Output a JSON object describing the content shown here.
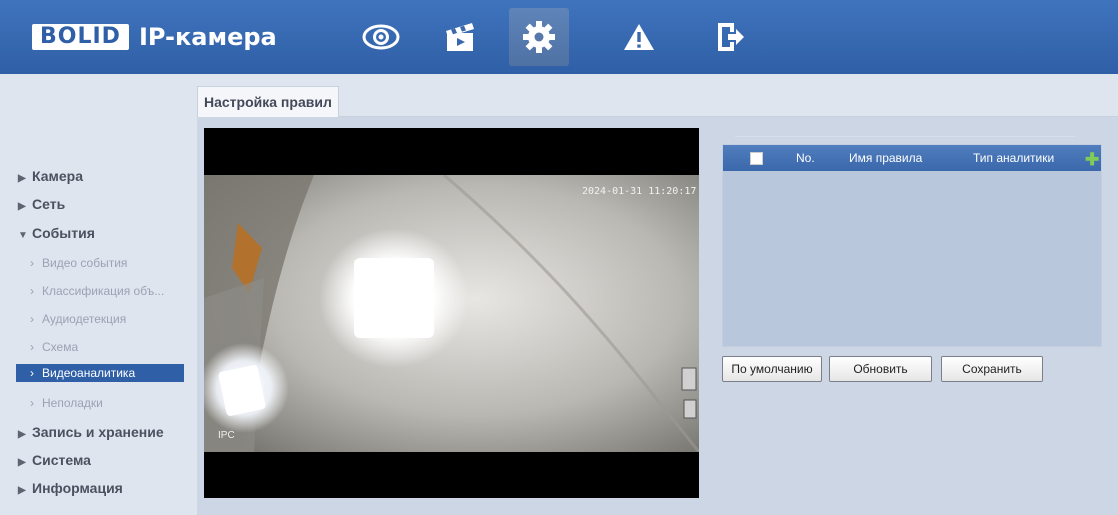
{
  "header": {
    "logo_box": "BOLID",
    "logo_text": "IP-камера",
    "nav_icons": [
      "eye-icon",
      "clapperboard-icon",
      "gear-icon",
      "warning-icon",
      "exit-icon"
    ],
    "active_nav": "gear-icon"
  },
  "sidebar": {
    "camera": "Камера",
    "network": "Сеть",
    "events": "События",
    "sub": {
      "video_events": "Видео события",
      "object_class": "Классификация объ...",
      "audio": "Аудиодетекция",
      "scheme": "Схема",
      "video_analytics": "Видеоаналитика",
      "faults": "Неполадки"
    },
    "record": "Запись и хранение",
    "system": "Система",
    "info": "Информация"
  },
  "tab": {
    "title": "Настройка правил"
  },
  "video": {
    "timestamp": "2024-01-31 11:20:17",
    "watermark": "IPC"
  },
  "rules_table": {
    "col_no": "No.",
    "col_name": "Имя правила",
    "col_type": "Тип аналитики",
    "rows": []
  },
  "buttons": {
    "default": "По умолчанию",
    "refresh": "Обновить",
    "save": "Сохранить"
  },
  "colors": {
    "header_blue": "#3f74bd",
    "active_item": "#2f5fa6",
    "panel_bg": "#ccd6e4",
    "plus_green": "#7fcc57"
  }
}
